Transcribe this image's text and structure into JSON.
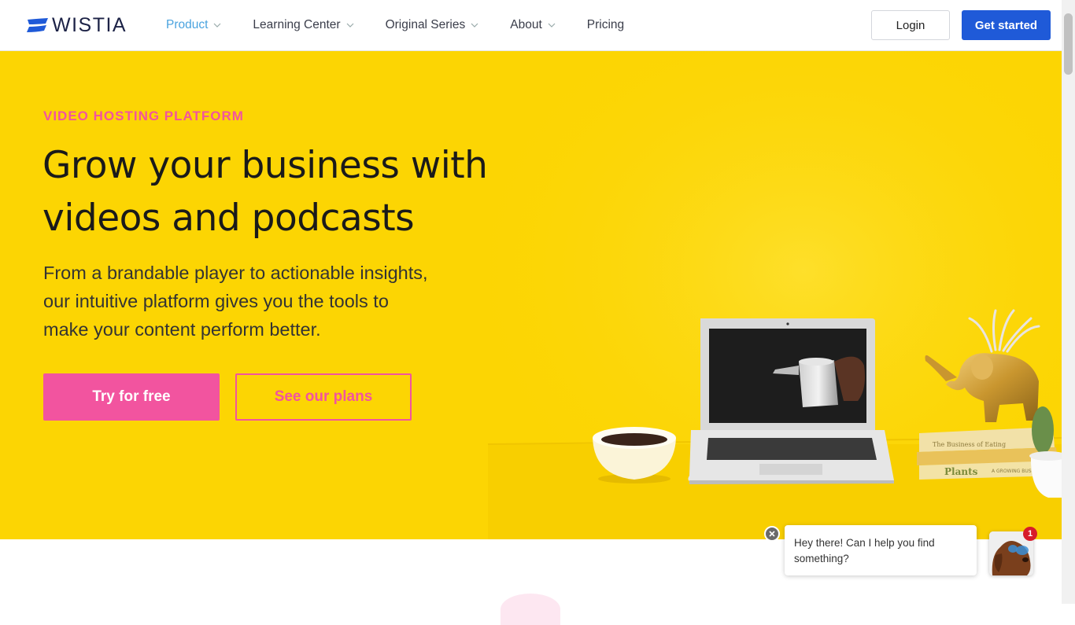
{
  "brand": {
    "name": "WISTIA",
    "primary_blue": "#1f5ad8",
    "navy": "#1c2246",
    "hero_yellow": "#fcd503",
    "pink": "#f2549f",
    "active_link": "#4aa3df"
  },
  "nav": {
    "items": [
      {
        "label": "Product",
        "has_dropdown": true,
        "active": true
      },
      {
        "label": "Learning Center",
        "has_dropdown": true
      },
      {
        "label": "Original Series",
        "has_dropdown": true
      },
      {
        "label": "About",
        "has_dropdown": true
      },
      {
        "label": "Pricing",
        "has_dropdown": false
      }
    ],
    "login_label": "Login",
    "cta_label": "Get started"
  },
  "hero": {
    "eyebrow": "VIDEO HOSTING PLATFORM",
    "headline_line1": "Grow your business with",
    "headline_line2": "videos and podcasts",
    "sub_line1": "From a brandable player to actionable insights,",
    "sub_line2": "our intuitive platform gives you the tools to",
    "sub_line3": "make your content perform better.",
    "primary_button": "Try for free",
    "secondary_button": "See our plans",
    "scene_book_texts": [
      "The Business of Eating",
      "Plants",
      "A GROWING BUSINESS"
    ]
  },
  "chat": {
    "message_line1": "Hey there! Can I help you find",
    "message_line2": "something?",
    "badge_count": "1",
    "close_icon": "close-icon"
  }
}
